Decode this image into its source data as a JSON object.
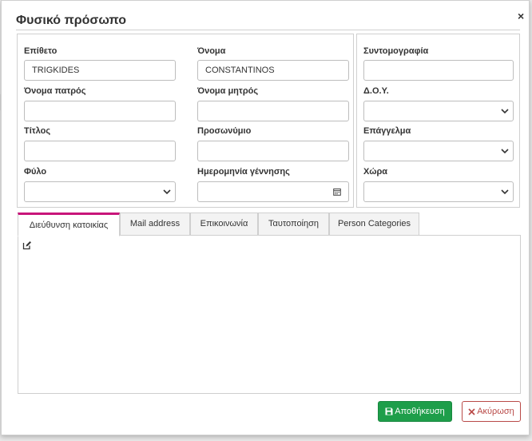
{
  "dialog": {
    "title": "Φυσικό πρόσωπο",
    "close_glyph": "×"
  },
  "form": {
    "surname": {
      "label": "Επίθετο",
      "value": "TRIGKIDES"
    },
    "first_name": {
      "label": "Όνομα",
      "value": "CONSTANTINOS"
    },
    "father_name": {
      "label": "Όνομα πατρός",
      "value": ""
    },
    "mother_name": {
      "label": "Όνομα μητρός",
      "value": ""
    },
    "title": {
      "label": "Τίτλος",
      "value": ""
    },
    "nickname": {
      "label": "Προσωνύμιο",
      "value": ""
    },
    "gender": {
      "label": "Φύλο",
      "value": ""
    },
    "birth_date": {
      "label": "Ημερομηνία γέννησης",
      "value": ""
    },
    "abbreviation": {
      "label": "Συντομογραφία",
      "value": ""
    },
    "tax_office": {
      "label": "Δ.Ο.Υ.",
      "value": ""
    },
    "profession": {
      "label": "Επάγγελμα",
      "value": ""
    },
    "country": {
      "label": "Χώρα",
      "value": ""
    }
  },
  "tabs": [
    {
      "label": "Διεύθυνση κατοικίας",
      "active": true
    },
    {
      "label": "Mail address",
      "active": false
    },
    {
      "label": "Επικοινωνία",
      "active": false
    },
    {
      "label": "Ταυτοποίηση",
      "active": false
    },
    {
      "label": "Person Categories",
      "active": false
    }
  ],
  "buttons": {
    "save_label": "Αποθήκευση",
    "cancel_label": "Ακύρωση"
  },
  "icons": {
    "close": "close-icon",
    "edit": "edit-icon",
    "calendar": "calendar-icon",
    "save": "floppy-icon",
    "cancel": "x-icon",
    "dropdown": "chevron-down-icon"
  },
  "colors": {
    "active_tab_accent": "#c8157a",
    "save_button": "#1e9e4a",
    "cancel_button": "#b94a48"
  }
}
